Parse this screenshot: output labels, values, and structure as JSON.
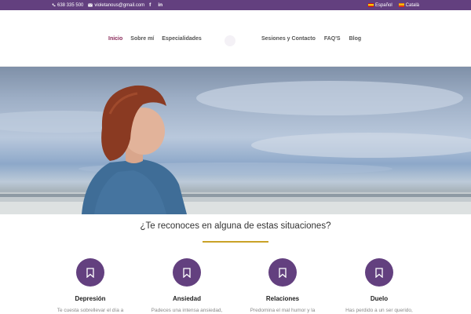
{
  "topbar": {
    "phone": "638 335 500",
    "email": "violetanous@gmail.com",
    "social": [
      "f",
      "in"
    ],
    "languages": [
      "Español",
      "Català"
    ]
  },
  "nav": {
    "left": [
      "Inicio",
      "Sobre mí",
      "Especialidades"
    ],
    "right": [
      "Sesiones y Contacto",
      "FAQ'S",
      "Blog"
    ],
    "active": "Inicio"
  },
  "section": {
    "title": "¿Te reconoces en alguna de estas situaciones?"
  },
  "cards": [
    {
      "icon": "bookmark-icon",
      "title": "Depresión",
      "desc": "Te cuesta sobrellevar el día a"
    },
    {
      "icon": "bookmark-icon",
      "title": "Ansiedad",
      "desc": "Padeces una intensa ansiedad,"
    },
    {
      "icon": "bookmark-icon",
      "title": "Relaciones",
      "desc": "Predomina el mal humor y la"
    },
    {
      "icon": "bookmark-icon",
      "title": "Duelo",
      "desc": "Has perdido a un ser querido,"
    }
  ],
  "colors": {
    "accent": "#63407f",
    "divider": "#c9a227",
    "active_nav": "#8a2a5a"
  }
}
